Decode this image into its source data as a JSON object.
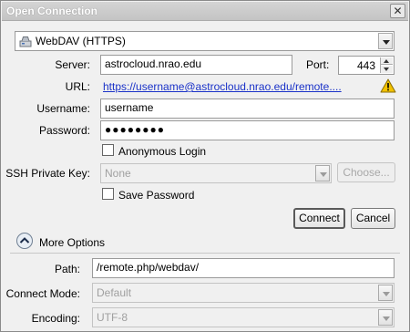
{
  "window": {
    "title": "Open Connection",
    "close_glyph": "✕"
  },
  "protocol": {
    "selected": "WebDAV (HTTPS)",
    "icon": "drive-icon"
  },
  "server": {
    "label": "Server:",
    "value": "astrocloud.nrao.edu"
  },
  "port": {
    "label": "Port:",
    "value": "443"
  },
  "url": {
    "label": "URL:",
    "value": "https://username@astrocloud.nrao.edu/remote...."
  },
  "username": {
    "label": "Username:",
    "value": "username"
  },
  "password": {
    "label": "Password:",
    "value": "●●●●●●●●"
  },
  "anonymous": {
    "label": "Anonymous Login",
    "checked": false
  },
  "ssh": {
    "label": "SSH Private Key:",
    "selected": "None",
    "choose_label": "Choose..."
  },
  "save_password": {
    "label": "Save Password",
    "checked": false
  },
  "buttons": {
    "connect": "Connect",
    "cancel": "Cancel"
  },
  "more_options": {
    "label": "More Options"
  },
  "path": {
    "label": "Path:",
    "value": "/remote.php/webdav/"
  },
  "connect_mode": {
    "label": "Connect Mode:",
    "selected": "Default"
  },
  "encoding": {
    "label": "Encoding:",
    "selected": "UTF-8"
  },
  "colors": {
    "link": "#1a32c8",
    "warning": "#f2c200"
  }
}
